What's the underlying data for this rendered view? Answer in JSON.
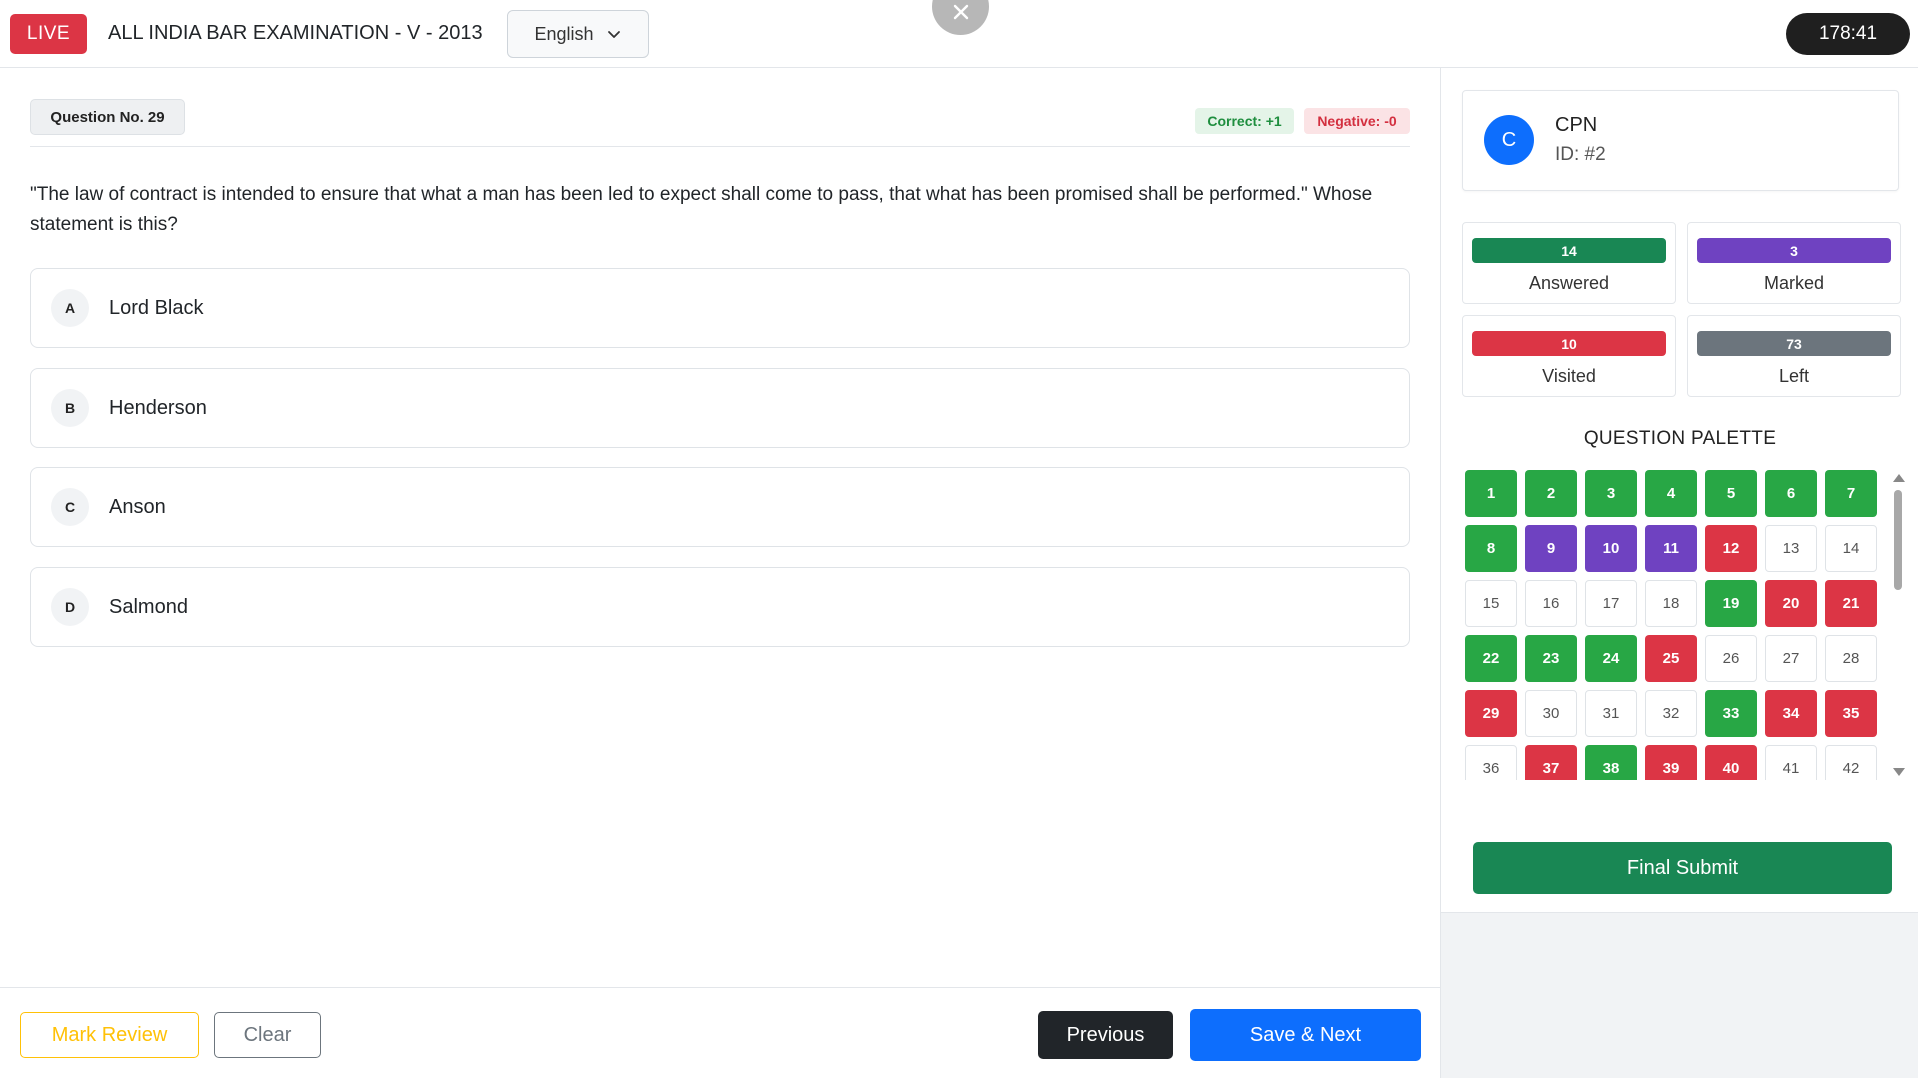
{
  "header": {
    "live_label": "LIVE",
    "exam_title": "ALL INDIA BAR EXAMINATION - V - 2013",
    "language": "English",
    "timer": "178:41"
  },
  "question": {
    "number_label": "Question No. 29",
    "correct_label": "Correct: +1",
    "negative_label": "Negative: -0",
    "text": "\"The law of contract is intended to ensure that what a man has been led to expect shall come to pass, that what has been promised shall be performed.\" Whose statement is this?",
    "options": [
      {
        "letter": "A",
        "text": "Lord Black"
      },
      {
        "letter": "B",
        "text": "Henderson"
      },
      {
        "letter": "C",
        "text": "Anson"
      },
      {
        "letter": "D",
        "text": "Salmond"
      }
    ]
  },
  "footer": {
    "mark_review": "Mark Review",
    "clear": "Clear",
    "previous": "Previous",
    "save_next": "Save & Next"
  },
  "user": {
    "initial": "C",
    "name": "CPN",
    "id": "ID: #2"
  },
  "stats": [
    {
      "count": "14",
      "label": "Answered",
      "color": "#198754"
    },
    {
      "count": "3",
      "label": "Marked",
      "color": "#6f42c1"
    },
    {
      "count": "10",
      "label": "Visited",
      "color": "#dc3545"
    },
    {
      "count": "73",
      "label": "Left",
      "color": "#6c757d"
    }
  ],
  "palette": {
    "title": "QUESTION PALETTE",
    "items": [
      {
        "n": "1",
        "s": "answered"
      },
      {
        "n": "2",
        "s": "answered"
      },
      {
        "n": "3",
        "s": "answered"
      },
      {
        "n": "4",
        "s": "answered"
      },
      {
        "n": "5",
        "s": "answered"
      },
      {
        "n": "6",
        "s": "answered"
      },
      {
        "n": "7",
        "s": "answered"
      },
      {
        "n": "8",
        "s": "answered"
      },
      {
        "n": "9",
        "s": "marked"
      },
      {
        "n": "10",
        "s": "marked"
      },
      {
        "n": "11",
        "s": "marked"
      },
      {
        "n": "12",
        "s": "visited"
      },
      {
        "n": "13",
        "s": "left"
      },
      {
        "n": "14",
        "s": "left"
      },
      {
        "n": "15",
        "s": "left"
      },
      {
        "n": "16",
        "s": "left"
      },
      {
        "n": "17",
        "s": "left"
      },
      {
        "n": "18",
        "s": "left"
      },
      {
        "n": "19",
        "s": "answered"
      },
      {
        "n": "20",
        "s": "visited"
      },
      {
        "n": "21",
        "s": "visited"
      },
      {
        "n": "22",
        "s": "answered"
      },
      {
        "n": "23",
        "s": "answered"
      },
      {
        "n": "24",
        "s": "answered"
      },
      {
        "n": "25",
        "s": "visited"
      },
      {
        "n": "26",
        "s": "left"
      },
      {
        "n": "27",
        "s": "left"
      },
      {
        "n": "28",
        "s": "left"
      },
      {
        "n": "29",
        "s": "visited"
      },
      {
        "n": "30",
        "s": "left"
      },
      {
        "n": "31",
        "s": "left"
      },
      {
        "n": "32",
        "s": "left"
      },
      {
        "n": "33",
        "s": "answered"
      },
      {
        "n": "34",
        "s": "visited"
      },
      {
        "n": "35",
        "s": "visited"
      },
      {
        "n": "36",
        "s": "left"
      },
      {
        "n": "37",
        "s": "visited"
      },
      {
        "n": "38",
        "s": "answered"
      },
      {
        "n": "39",
        "s": "visited"
      },
      {
        "n": "40",
        "s": "visited"
      },
      {
        "n": "41",
        "s": "left"
      },
      {
        "n": "42",
        "s": "left"
      }
    ]
  },
  "final_submit": "Final Submit"
}
